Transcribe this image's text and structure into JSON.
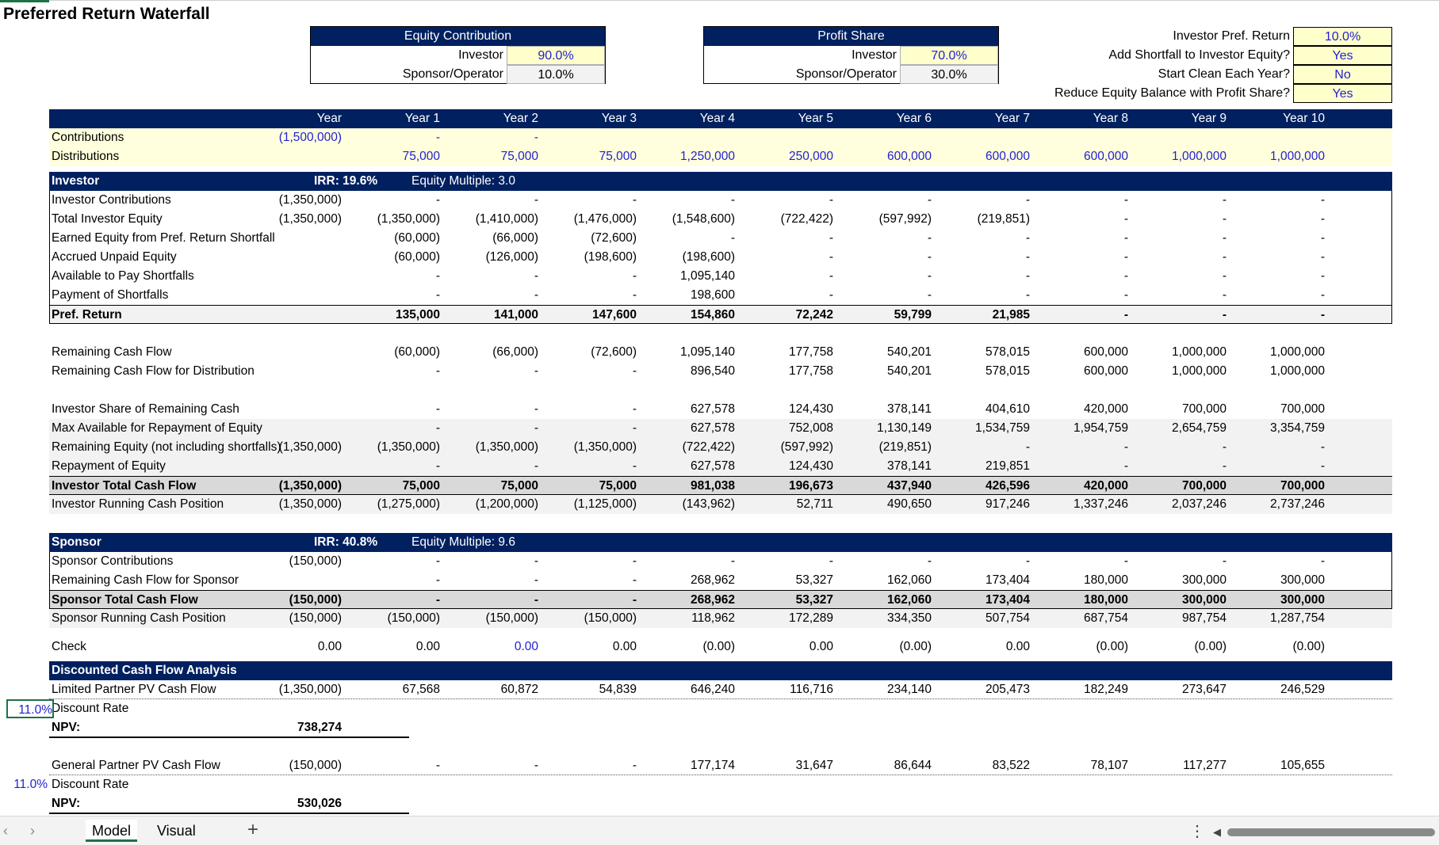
{
  "title": "Preferred Return Waterfall",
  "equity_contribution": {
    "header": "Equity Contribution",
    "rows": [
      {
        "label": "Investor",
        "value": "90.0%",
        "input": true
      },
      {
        "label": "Sponsor/Operator",
        "value": "10.0%",
        "input": false
      }
    ]
  },
  "profit_share": {
    "header": "Profit Share",
    "rows": [
      {
        "label": "Investor",
        "value": "70.0%",
        "input": true
      },
      {
        "label": "Sponsor/Operator",
        "value": "30.0%",
        "input": false
      }
    ]
  },
  "settings": [
    {
      "label": "Investor Pref. Return",
      "value": "10.0%"
    },
    {
      "label": "Add Shortfall to Investor Equity?",
      "value": "Yes"
    },
    {
      "label": "Start Clean Each Year?",
      "value": "No"
    },
    {
      "label": "Reduce Equity Balance with Profit Share?",
      "value": "Yes"
    }
  ],
  "years": [
    "Year",
    "Year 1",
    "Year 2",
    "Year 3",
    "Year 4",
    "Year 5",
    "Year 6",
    "Year 7",
    "Year 8",
    "Year 9",
    "Year 10"
  ],
  "inputs": [
    {
      "label": "Contributions",
      "values": [
        "(1,500,000)",
        "-",
        "-",
        "",
        "",
        "",
        "",
        "",
        "",
        "",
        ""
      ]
    },
    {
      "label": "Distributions",
      "values": [
        "",
        "75,000",
        "75,000",
        "75,000",
        "1,250,000",
        "250,000",
        "600,000",
        "600,000",
        "600,000",
        "1,000,000",
        "1,000,000"
      ]
    }
  ],
  "investor": {
    "band": {
      "label": "Investor",
      "irr": "IRR: 19.6%",
      "multiple": "Equity Multiple: 3.0"
    },
    "rows": [
      {
        "label": "Investor Contributions",
        "values": [
          "(1,350,000)",
          "-",
          "-",
          "-",
          "-",
          "-",
          "-",
          "-",
          "-",
          "-",
          "-"
        ]
      },
      {
        "label": "Total Investor Equity",
        "values": [
          "(1,350,000)",
          "(1,350,000)",
          "(1,410,000)",
          "(1,476,000)",
          "(1,548,600)",
          "(722,422)",
          "(597,992)",
          "(219,851)",
          "-",
          "-",
          "-"
        ]
      },
      {
        "label": "Earned Equity from Pref. Return Shortfall",
        "values": [
          "",
          "(60,000)",
          "(66,000)",
          "(72,600)",
          "-",
          "-",
          "-",
          "-",
          "-",
          "-",
          "-"
        ]
      },
      {
        "label": "Accrued Unpaid Equity",
        "values": [
          "",
          "(60,000)",
          "(126,000)",
          "(198,600)",
          "(198,600)",
          "-",
          "-",
          "-",
          "-",
          "-",
          "-"
        ]
      },
      {
        "label": "Available to Pay Shortfalls",
        "values": [
          "",
          "-",
          "-",
          "-",
          "1,095,140",
          "-",
          "-",
          "-",
          "-",
          "-",
          "-"
        ]
      },
      {
        "label": "Payment of Shortfalls",
        "values": [
          "",
          "-",
          "-",
          "-",
          "198,600",
          "-",
          "-",
          "-",
          "-",
          "-",
          "-"
        ]
      }
    ],
    "pref": {
      "label": "Pref. Return",
      "values": [
        "",
        "135,000",
        "141,000",
        "147,600",
        "154,860",
        "72,242",
        "59,799",
        "21,985",
        "-",
        "-",
        "-"
      ]
    },
    "remaining": [
      {
        "label": "Remaining Cash Flow",
        "values": [
          "",
          "(60,000)",
          "(66,000)",
          "(72,600)",
          "1,095,140",
          "177,758",
          "540,201",
          "578,015",
          "600,000",
          "1,000,000",
          "1,000,000"
        ]
      },
      {
        "label": "Remaining Cash Flow for Distribution",
        "values": [
          "",
          "-",
          "-",
          "-",
          "896,540",
          "177,758",
          "540,201",
          "578,015",
          "600,000",
          "1,000,000",
          "1,000,000"
        ]
      }
    ],
    "share": [
      {
        "label": "Investor Share of Remaining Cash",
        "values": [
          "",
          "-",
          "-",
          "-",
          "627,578",
          "124,430",
          "378,141",
          "404,610",
          "420,000",
          "700,000",
          "700,000"
        ]
      },
      {
        "label": "Max Available for Repayment of Equity",
        "values": [
          "",
          "-",
          "-",
          "-",
          "627,578",
          "752,008",
          "1,130,149",
          "1,534,759",
          "1,954,759",
          "2,654,759",
          "3,354,759"
        ]
      },
      {
        "label": "Remaining Equity (not including shortfalls)",
        "values": [
          "(1,350,000)",
          "(1,350,000)",
          "(1,350,000)",
          "(1,350,000)",
          "(722,422)",
          "(597,992)",
          "(219,851)",
          "-",
          "-",
          "-",
          "-"
        ]
      },
      {
        "label": "Repayment of Equity",
        "values": [
          "",
          "-",
          "-",
          "-",
          "627,578",
          "124,430",
          "378,141",
          "219,851",
          "-",
          "-",
          "-"
        ]
      }
    ],
    "total": {
      "label": "Investor Total Cash Flow",
      "values": [
        "(1,350,000)",
        "75,000",
        "75,000",
        "75,000",
        "981,038",
        "196,673",
        "437,940",
        "426,596",
        "420,000",
        "700,000",
        "700,000"
      ]
    },
    "running": {
      "label": "Investor Running Cash Position",
      "values": [
        "(1,350,000)",
        "(1,275,000)",
        "(1,200,000)",
        "(1,125,000)",
        "(143,962)",
        "52,711",
        "490,650",
        "917,246",
        "1,337,246",
        "2,037,246",
        "2,737,246"
      ]
    }
  },
  "sponsor": {
    "band": {
      "label": "Sponsor",
      "irr": "IRR: 40.8%",
      "multiple": "Equity Multiple: 9.6"
    },
    "rows": [
      {
        "label": "Sponsor Contributions",
        "values": [
          "(150,000)",
          "-",
          "-",
          "-",
          "-",
          "-",
          "-",
          "-",
          "-",
          "-",
          "-"
        ]
      },
      {
        "label": "Remaining Cash Flow for Sponsor",
        "values": [
          "",
          "-",
          "-",
          "-",
          "268,962",
          "53,327",
          "162,060",
          "173,404",
          "180,000",
          "300,000",
          "300,000"
        ]
      }
    ],
    "total": {
      "label": "Sponsor Total Cash Flow",
      "values": [
        "(150,000)",
        "-",
        "-",
        "-",
        "268,962",
        "53,327",
        "162,060",
        "173,404",
        "180,000",
        "300,000",
        "300,000"
      ]
    },
    "running": {
      "label": "Sponsor Running Cash Position",
      "values": [
        "(150,000)",
        "(150,000)",
        "(150,000)",
        "(150,000)",
        "118,962",
        "172,289",
        "334,350",
        "507,754",
        "687,754",
        "987,754",
        "1,287,754"
      ]
    }
  },
  "check": {
    "label": "Check",
    "values": [
      "0.00",
      "0.00",
      "0.00",
      "0.00",
      "(0.00)",
      "0.00",
      "(0.00)",
      "0.00",
      "(0.00)",
      "(0.00)",
      "(0.00)"
    ]
  },
  "dcf": {
    "band": "Discounted Cash Flow Analysis",
    "lp": {
      "label": "Limited Partner PV Cash Flow",
      "values": [
        "(1,350,000)",
        "67,568",
        "60,872",
        "54,839",
        "646,240",
        "116,716",
        "234,140",
        "205,473",
        "182,249",
        "273,647",
        "246,529"
      ]
    },
    "lp_rate": "11.0%",
    "lp_rate_label": "Discount Rate",
    "lp_npv_label": "NPV:",
    "lp_npv": "738,274",
    "gp": {
      "label": "General Partner PV Cash Flow",
      "values": [
        "(150,000)",
        "-",
        "-",
        "-",
        "177,174",
        "31,647",
        "86,644",
        "83,522",
        "78,107",
        "117,277",
        "105,655"
      ]
    },
    "gp_rate": "11.0%",
    "gp_rate_label": "Discount Rate",
    "gp_npv_label": "NPV:",
    "gp_npv": "530,026"
  },
  "tabs": {
    "prev": "‹",
    "next": "›",
    "items": [
      "Model",
      "Visual"
    ],
    "add": "+",
    "more": "⋮",
    "scroll_left": "◀"
  }
}
